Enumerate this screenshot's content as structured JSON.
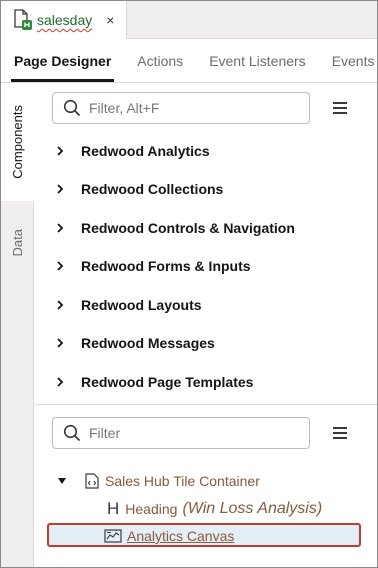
{
  "file_tab": {
    "name": "salesday",
    "close_glyph": "×",
    "icon": "page-file-icon"
  },
  "designer_tabs": [
    {
      "label": "Page Designer",
      "active": true
    },
    {
      "label": "Actions",
      "active": false
    },
    {
      "label": "Event Listeners",
      "active": false
    },
    {
      "label": "Events",
      "active": false
    }
  ],
  "side_tabs": [
    {
      "label": "Components",
      "active": true
    },
    {
      "label": "Data",
      "active": false
    }
  ],
  "components": {
    "search_placeholder": "Filter, Alt+F",
    "groups": [
      "Redwood Analytics",
      "Redwood Collections",
      "Redwood Controls & Navigation",
      "Redwood Forms & Inputs",
      "Redwood Layouts",
      "Redwood Messages",
      "Redwood Page Templates"
    ]
  },
  "structure": {
    "search_placeholder": "Filter",
    "tree": {
      "container": {
        "label": "Sales Hub Tile Container",
        "expanded": true
      },
      "heading": {
        "label": "Heading",
        "detail": "(Win Loss Analysis)"
      },
      "canvas": {
        "label": "Analytics Canvas",
        "selected": true
      }
    }
  },
  "colors": {
    "selection_border": "#c43a2c",
    "selection_fill": "#e4eef6",
    "tree_text": "#8a5a3c",
    "file_name": "#1f6d2c"
  }
}
